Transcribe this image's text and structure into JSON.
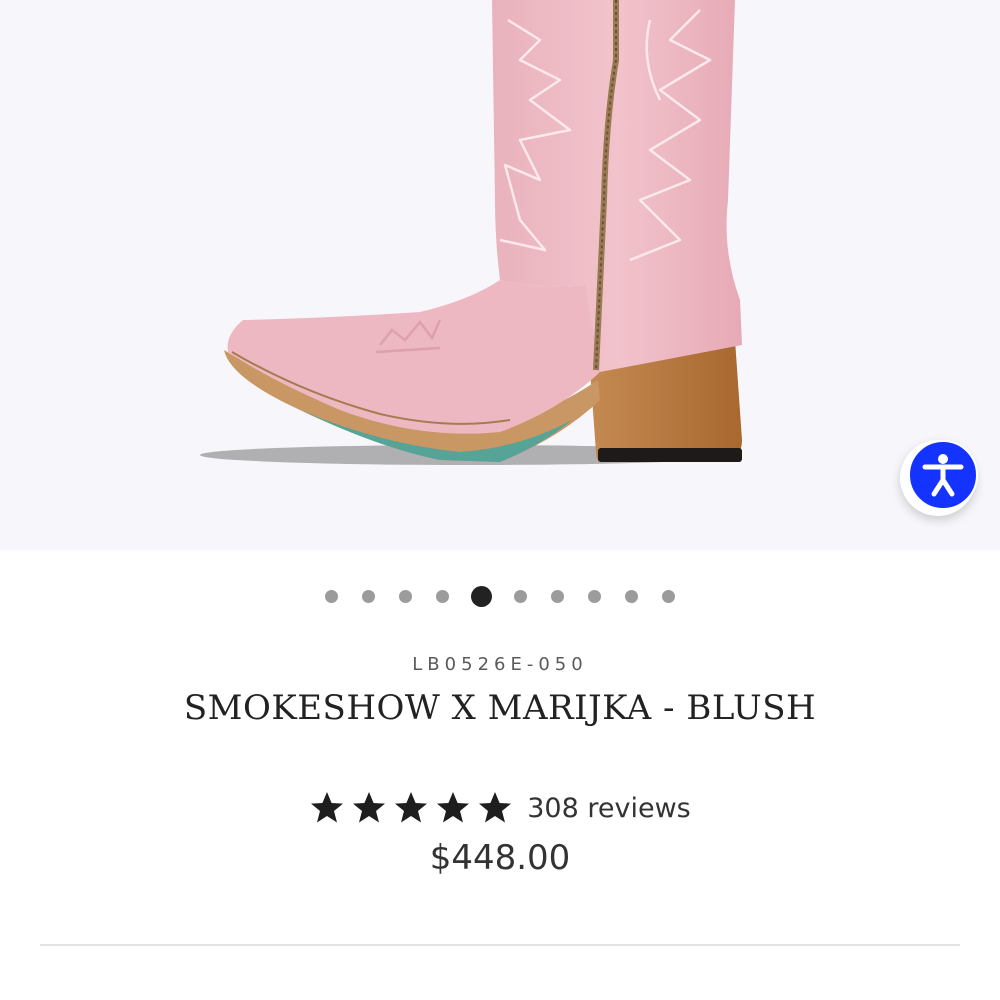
{
  "product": {
    "sku": "LB0526E-050",
    "title": "SMOKESHOW X MARIJKA - BLUSH",
    "rating": 5,
    "rating_max": 5,
    "reviews_text": "308 reviews",
    "price": "$448.00",
    "image_subject": "pink western boot"
  },
  "carousel": {
    "total_slides": 10,
    "active_index": 4
  },
  "colors": {
    "boot_pink": "#efbcc6",
    "stitching": "#fbe9ec",
    "heel_wood": "#b5773f",
    "accessibility_blue": "#1433ff",
    "active_dot": "#222222",
    "inactive_dot": "#9b9b9b"
  },
  "icons": {
    "accessibility": "accessibility-person-icon",
    "star": "star-icon"
  }
}
